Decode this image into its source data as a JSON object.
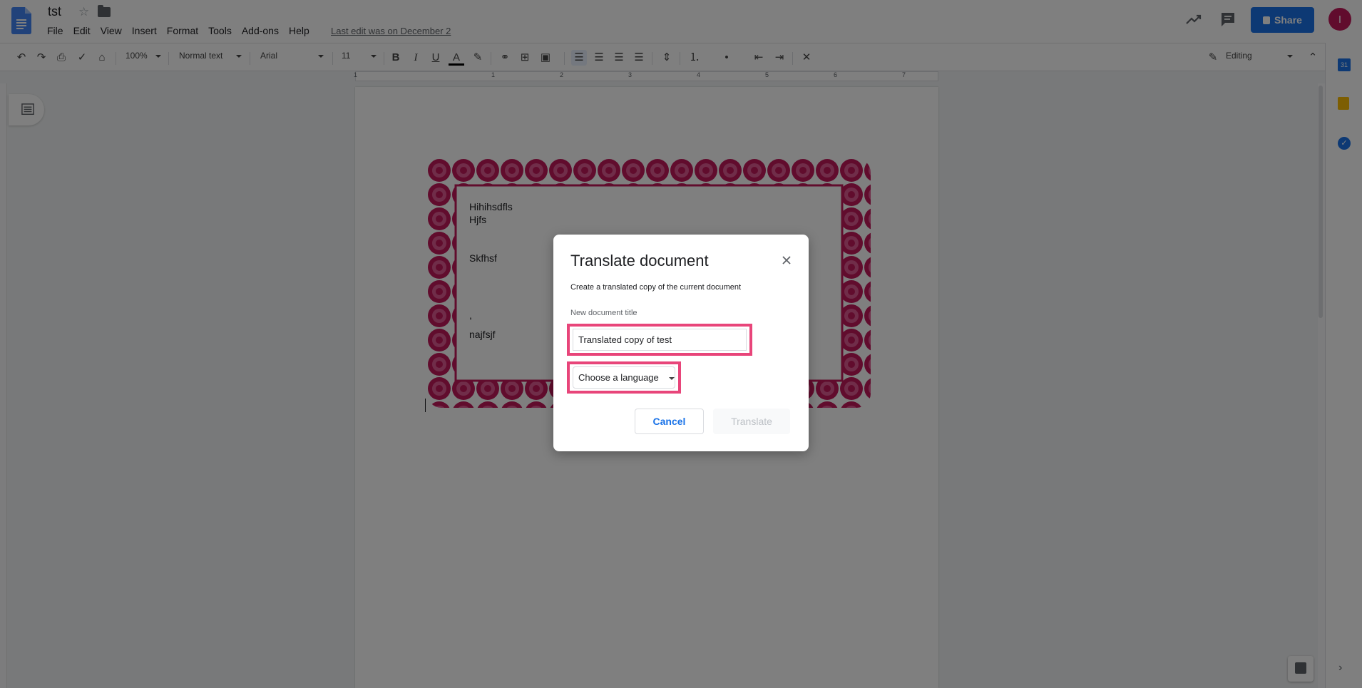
{
  "app": {
    "doc_title": "tst",
    "menu": [
      "File",
      "Edit",
      "View",
      "Insert",
      "Format",
      "Tools",
      "Add-ons",
      "Help"
    ],
    "last_edit": "Last edit was on December 2",
    "share_label": "Share",
    "avatar_letter": "I"
  },
  "toolbar": {
    "zoom": "100%",
    "style": "Normal text",
    "font": "Arial",
    "font_size": "11",
    "mode": "Editing"
  },
  "ruler": {
    "numbers": [
      "1",
      "1",
      "2",
      "3",
      "4",
      "5",
      "6",
      "7"
    ]
  },
  "document": {
    "lines": [
      "Hihihsdfls",
      "Hjfs",
      "Skfhsf",
      ",",
      "najfsjf"
    ]
  },
  "dialog": {
    "title": "Translate document",
    "description": "Create a translated copy of the current document",
    "title_label": "New document title",
    "title_value": "Translated copy of test",
    "language_placeholder": "Choose a language",
    "cancel_label": "Cancel",
    "translate_label": "Translate"
  },
  "colors": {
    "accent": "#1a73e8",
    "highlight": "#e8457a",
    "frame": "#c2185b"
  }
}
